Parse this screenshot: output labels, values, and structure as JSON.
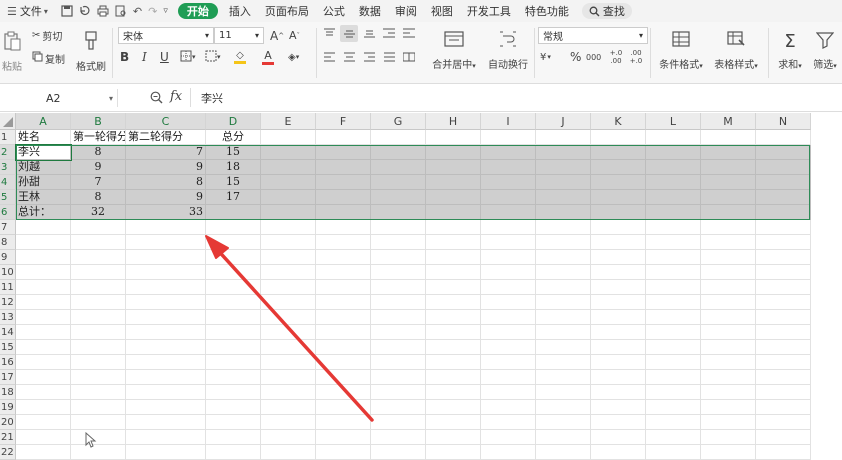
{
  "menu": {
    "file_label": "文件",
    "tabs": [
      "开始",
      "插入",
      "页面布局",
      "公式",
      "数据",
      "审阅",
      "视图",
      "开发工具",
      "特色功能"
    ],
    "active_tab": "开始",
    "search_label": "查找"
  },
  "ribbon": {
    "paste": "粘贴",
    "cut": "剪切",
    "copy": "复制",
    "format_painter": "格式刷",
    "font_name": "宋体",
    "font_size": "11",
    "bold": "B",
    "italic": "I",
    "underline": "U",
    "merge_center": "合并居中",
    "wrap_text": "自动换行",
    "number_format": "常规",
    "currency": "¥",
    "percent": "%",
    "thousands": "000",
    "inc_decimal": "+.0 .00",
    "dec_decimal": ".00 +.0",
    "cond_format": "条件格式",
    "table_style": "表格样式",
    "sum": "求和",
    "filter": "筛选"
  },
  "formula_bar": {
    "cell_ref": "A2",
    "fx": "fx",
    "value": "李兴"
  },
  "columns": [
    "A",
    "B",
    "C",
    "D",
    "E",
    "F",
    "G",
    "H",
    "I",
    "J",
    "K",
    "L",
    "M",
    "N"
  ],
  "rows": [
    "1",
    "2",
    "3",
    "4",
    "5",
    "6",
    "7",
    "8",
    "9",
    "10",
    "11",
    "12",
    "13",
    "14",
    "15",
    "16",
    "17",
    "18",
    "19",
    "20",
    "21",
    "22"
  ],
  "table": [
    [
      "姓名",
      "第一轮得分",
      "第二轮得分",
      "总分"
    ],
    [
      "李兴",
      "8",
      "7",
      "15"
    ],
    [
      "刘越",
      "9",
      "9",
      "18"
    ],
    [
      "孙甜",
      "7",
      "8",
      "15"
    ],
    [
      "王林",
      "8",
      "9",
      "17"
    ],
    [
      "总计：",
      "32",
      "33",
      ""
    ]
  ],
  "colors": {
    "accent": "#1f9d55",
    "selection": "#cfcfcf",
    "arrow": "#e53935"
  }
}
